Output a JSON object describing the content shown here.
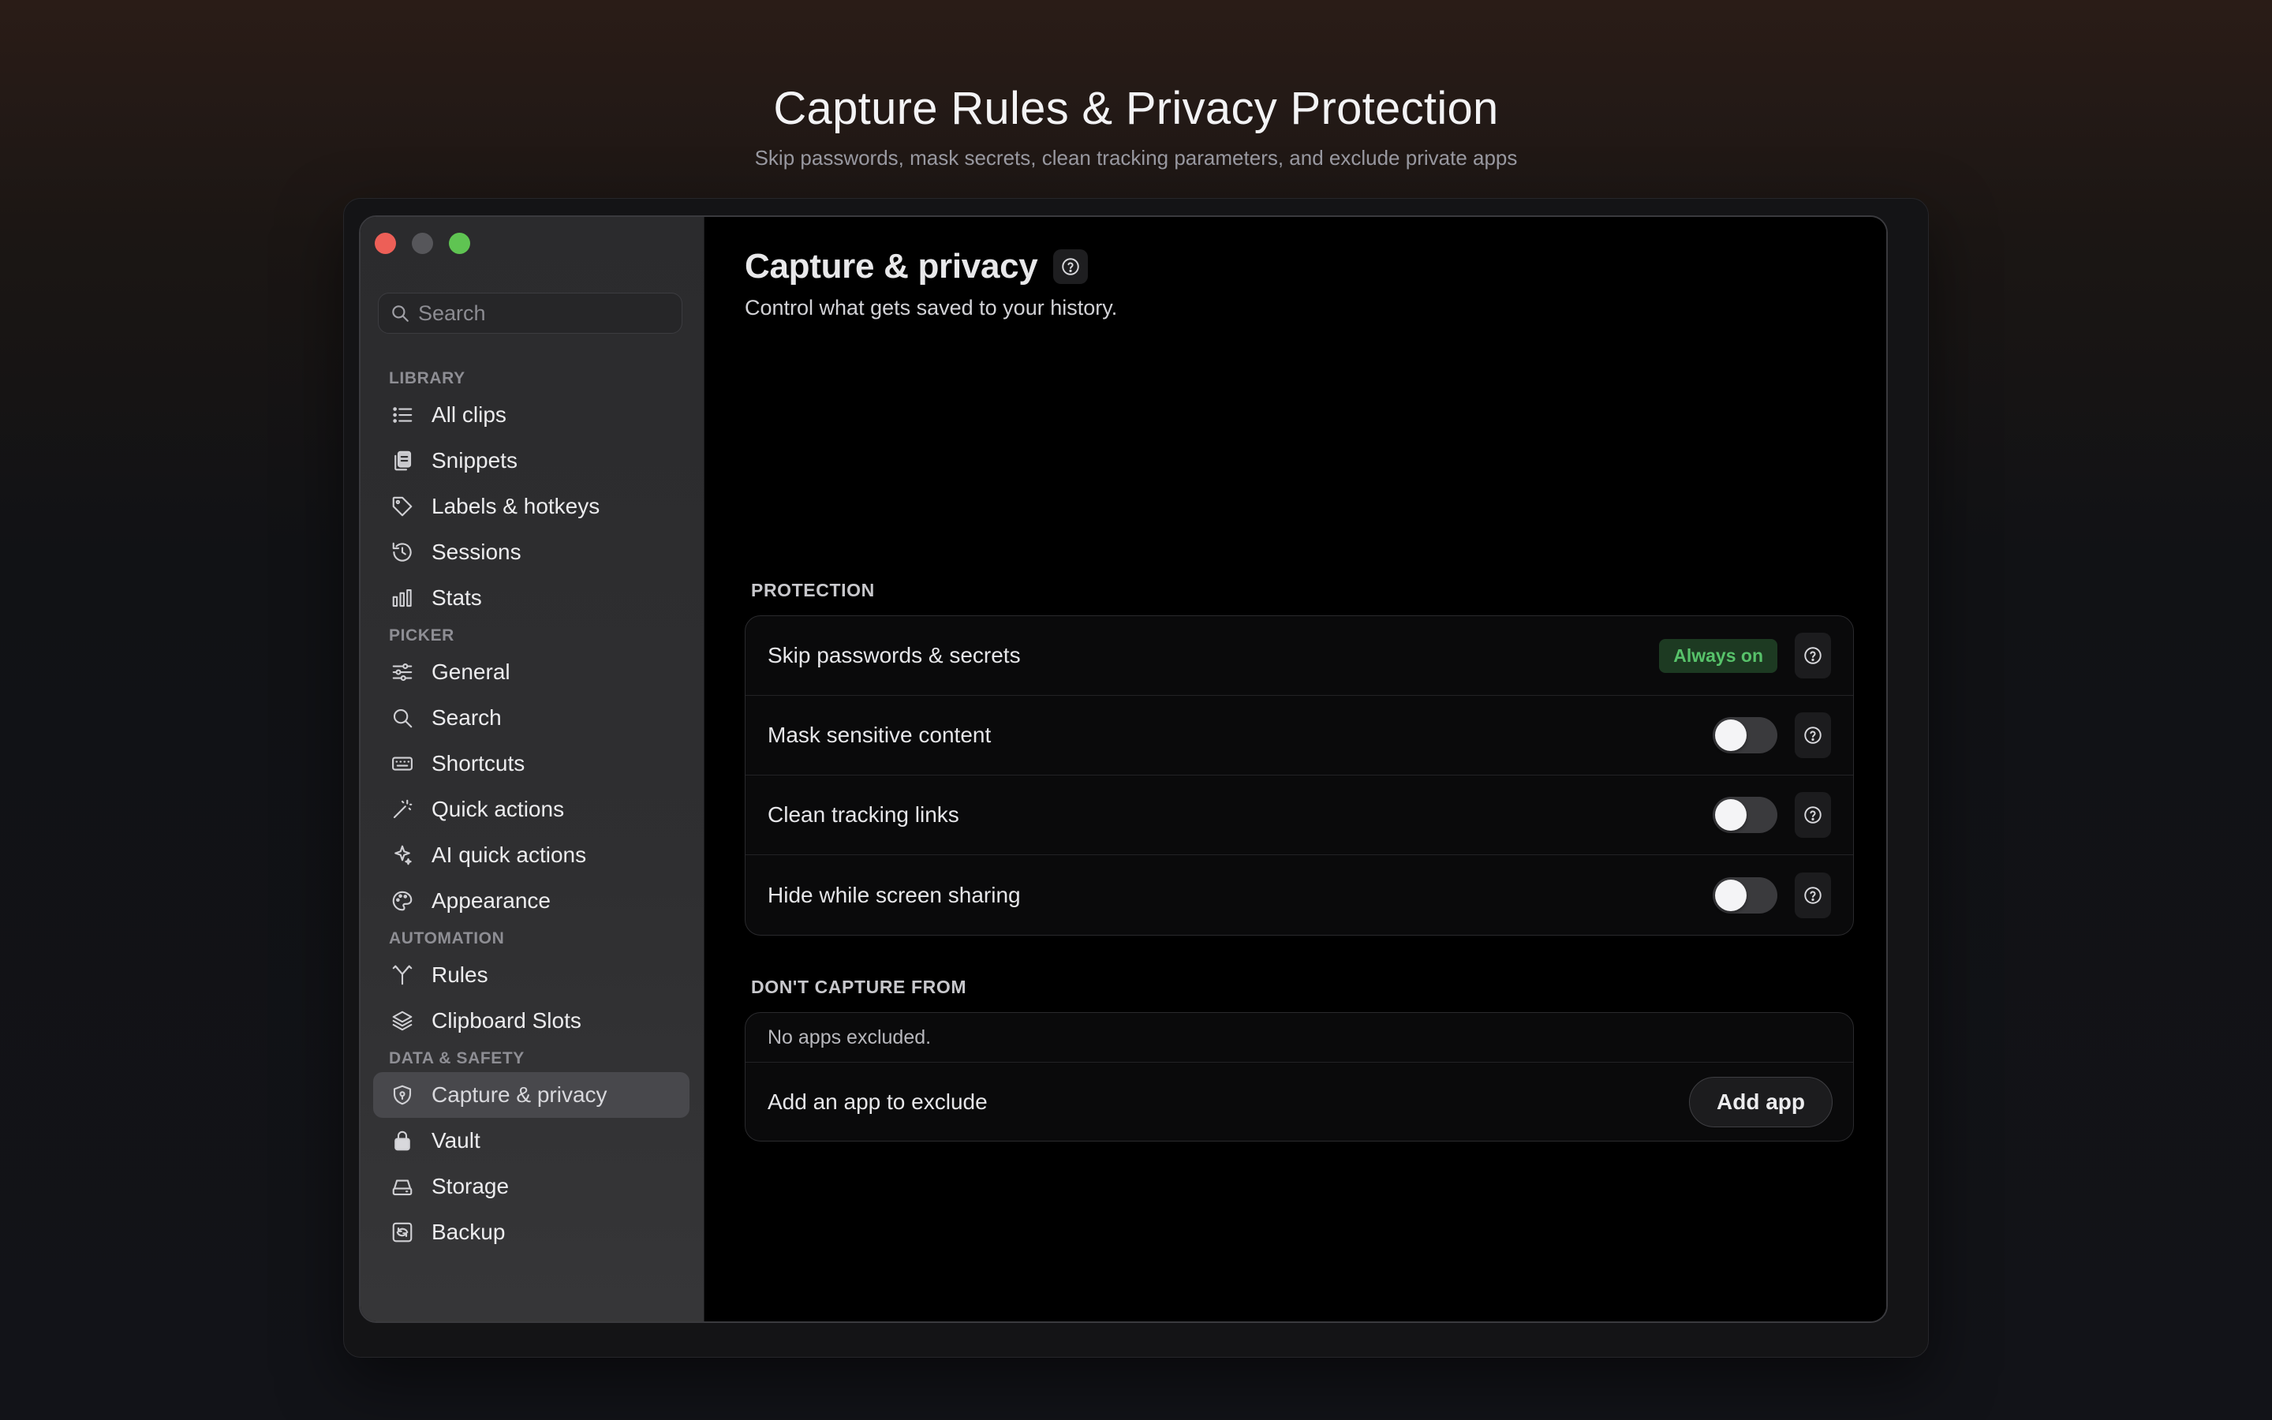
{
  "hero": {
    "title": "Capture Rules & Privacy Protection",
    "subtitle": "Skip passwords, mask secrets, clean tracking parameters, and exclude private apps"
  },
  "search": {
    "placeholder": "Search",
    "value": ""
  },
  "sidebar": {
    "sections": [
      {
        "label": "LIBRARY",
        "items": [
          {
            "label": "All clips",
            "icon": "list-icon"
          },
          {
            "label": "Snippets",
            "icon": "documents-icon"
          },
          {
            "label": "Labels & hotkeys",
            "icon": "tag-icon"
          },
          {
            "label": "Sessions",
            "icon": "history-icon"
          },
          {
            "label": "Stats",
            "icon": "bar-chart-icon"
          }
        ]
      },
      {
        "label": "PICKER",
        "items": [
          {
            "label": "General",
            "icon": "sliders-icon"
          },
          {
            "label": "Search",
            "icon": "search-icon"
          },
          {
            "label": "Shortcuts",
            "icon": "keyboard-icon"
          },
          {
            "label": "Quick actions",
            "icon": "magic-wand-icon"
          },
          {
            "label": "AI quick actions",
            "icon": "sparkles-icon"
          },
          {
            "label": "Appearance",
            "icon": "palette-icon"
          }
        ]
      },
      {
        "label": "AUTOMATION",
        "items": [
          {
            "label": "Rules",
            "icon": "branch-icon"
          },
          {
            "label": "Clipboard Slots",
            "icon": "layers-icon"
          }
        ]
      },
      {
        "label": "DATA & SAFETY",
        "items": [
          {
            "label": "Capture & privacy",
            "icon": "shield-icon",
            "active": true
          },
          {
            "label": "Vault",
            "icon": "lock-icon"
          },
          {
            "label": "Storage",
            "icon": "drive-icon"
          },
          {
            "label": "Backup",
            "icon": "backup-icon"
          }
        ]
      }
    ]
  },
  "main": {
    "title": "Capture & privacy",
    "subtitle": "Control what gets saved to your history.",
    "protection": {
      "label": "PROTECTION",
      "rows": [
        {
          "label": "Skip passwords & secrets",
          "badge": "Always on"
        },
        {
          "label": "Mask sensitive content",
          "enabled": false
        },
        {
          "label": "Clean tracking links",
          "enabled": false
        },
        {
          "label": "Hide while screen sharing",
          "enabled": false
        }
      ]
    },
    "exclusions": {
      "label": "DON'T CAPTURE FROM",
      "empty_text": "No apps excluded.",
      "add_label": "Add an app to exclude",
      "add_button": "Add app"
    }
  },
  "colors": {
    "accent_green": "#57c26a",
    "close": "#ed5f57",
    "zoom": "#5fc452",
    "active_item": "#48484c"
  }
}
